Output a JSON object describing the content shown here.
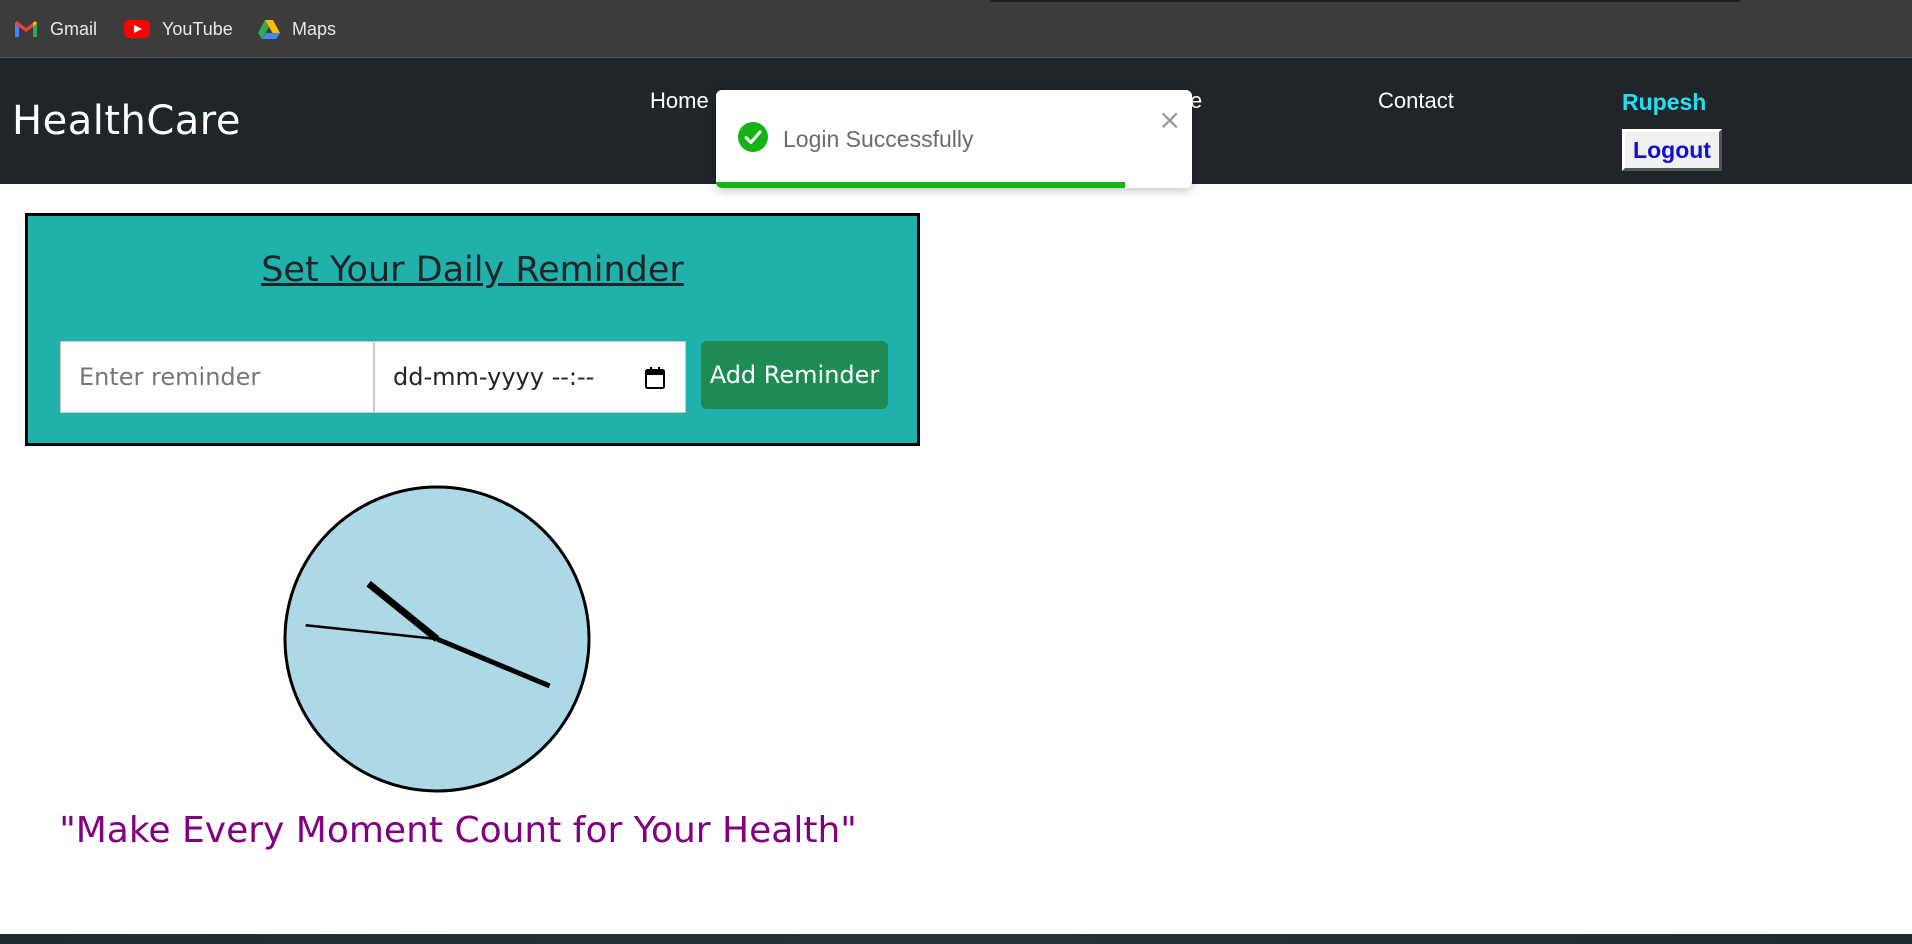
{
  "bookmarks": [
    {
      "label": "Gmail",
      "icon": "gmail-icon"
    },
    {
      "label": "YouTube",
      "icon": "youtube-icon"
    },
    {
      "label": "Maps",
      "icon": "maps-icon"
    }
  ],
  "navbar": {
    "brand": "HealthCare",
    "links": {
      "home": "Home",
      "hidden_partial": "e",
      "contact": "Contact"
    },
    "username": "Rupesh",
    "logout_label": "Logout",
    "colors": {
      "background": "#212529",
      "username": "#22e0f0",
      "logout_text": "#1010d0"
    }
  },
  "toast": {
    "message": "Login Successfully",
    "close_glyph": "×",
    "progress_fraction": 0.86,
    "colors": {
      "success": "#16b316"
    }
  },
  "reminder": {
    "title": "Set Your Daily Reminder",
    "input_placeholder": "Enter reminder",
    "input_value": "",
    "datetime_placeholder": "dd-mm-yyyy --:--",
    "add_button_label": "Add Reminder",
    "colors": {
      "card": "#20b2aa",
      "button": "#1e8a54"
    }
  },
  "clock": {
    "face_color": "#add8e6",
    "hour": 10,
    "minute": 18,
    "second": 46
  },
  "quote": {
    "text": "\"Make Every Moment Count for Your Health\"",
    "color": "#800080"
  }
}
